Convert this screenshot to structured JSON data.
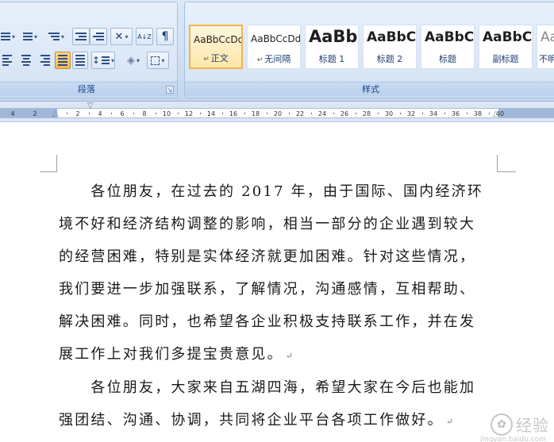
{
  "ribbon": {
    "paragraph_group_label": "段落",
    "styles_group_label": "样式",
    "launcher_glyph": "↘",
    "paragraph_tools": {
      "sort_glyph": "A↓Z",
      "show_marks_glyph": "¶",
      "line_spacing_glyph": "↕",
      "shading_glyph": "◈",
      "dropdown_glyph": "▾"
    },
    "styles": [
      {
        "preview": "AaBbCcDd",
        "name": "正文",
        "mark": "↵",
        "selected": true
      },
      {
        "preview": "AaBbCcDd",
        "name": "无间隔",
        "mark": "↵",
        "selected": false
      },
      {
        "preview": "AaBb",
        "name": "标题 1",
        "mark": "",
        "selected": false
      },
      {
        "preview": "AaBbC",
        "name": "标题 2",
        "mark": "",
        "selected": false
      },
      {
        "preview": "AaBbC",
        "name": "标题",
        "mark": "",
        "selected": false
      },
      {
        "preview": "AaBbC",
        "name": "副标题",
        "mark": "",
        "selected": false
      },
      {
        "preview": "AaBbC",
        "name": "不明",
        "mark": "",
        "selected": false
      }
    ]
  },
  "ruler": {
    "left_ticks": [
      "4",
      "2"
    ],
    "right_ticks": [
      "2",
      "4",
      "6",
      "8",
      "10",
      "12",
      "14",
      "16",
      "18",
      "20",
      "22",
      "24",
      "26",
      "28",
      "30",
      "32",
      "34",
      "36",
      "38",
      "40"
    ]
  },
  "document": {
    "paragraph1": [
      "　　各位朋友，在过去的 2017 年，由于国际、国内经济环",
      "境不好和经济结构调整的影响，相当一部分的企业遇到较大",
      "的经营困难，特别是实体经济就更加困难。针对这些情况，",
      "我们要进一步加强联系，了解情况，沟通感情，互相帮助、",
      "解决困难。同时，也希望各企业积极支持联系工作，并在发",
      "展工作上对我们多提宝贵意见。"
    ],
    "paragraph2": [
      "　　各位朋友，大家来自五湖四海，希望大家在今后也能加",
      "强团结、沟通、协调，共同将企业平台各项工作做好。"
    ],
    "paragraph_mark": "↵"
  },
  "watermark": {
    "logo_glyph": "✿",
    "text": "经验",
    "sub": "jingyan.baidu.com"
  }
}
